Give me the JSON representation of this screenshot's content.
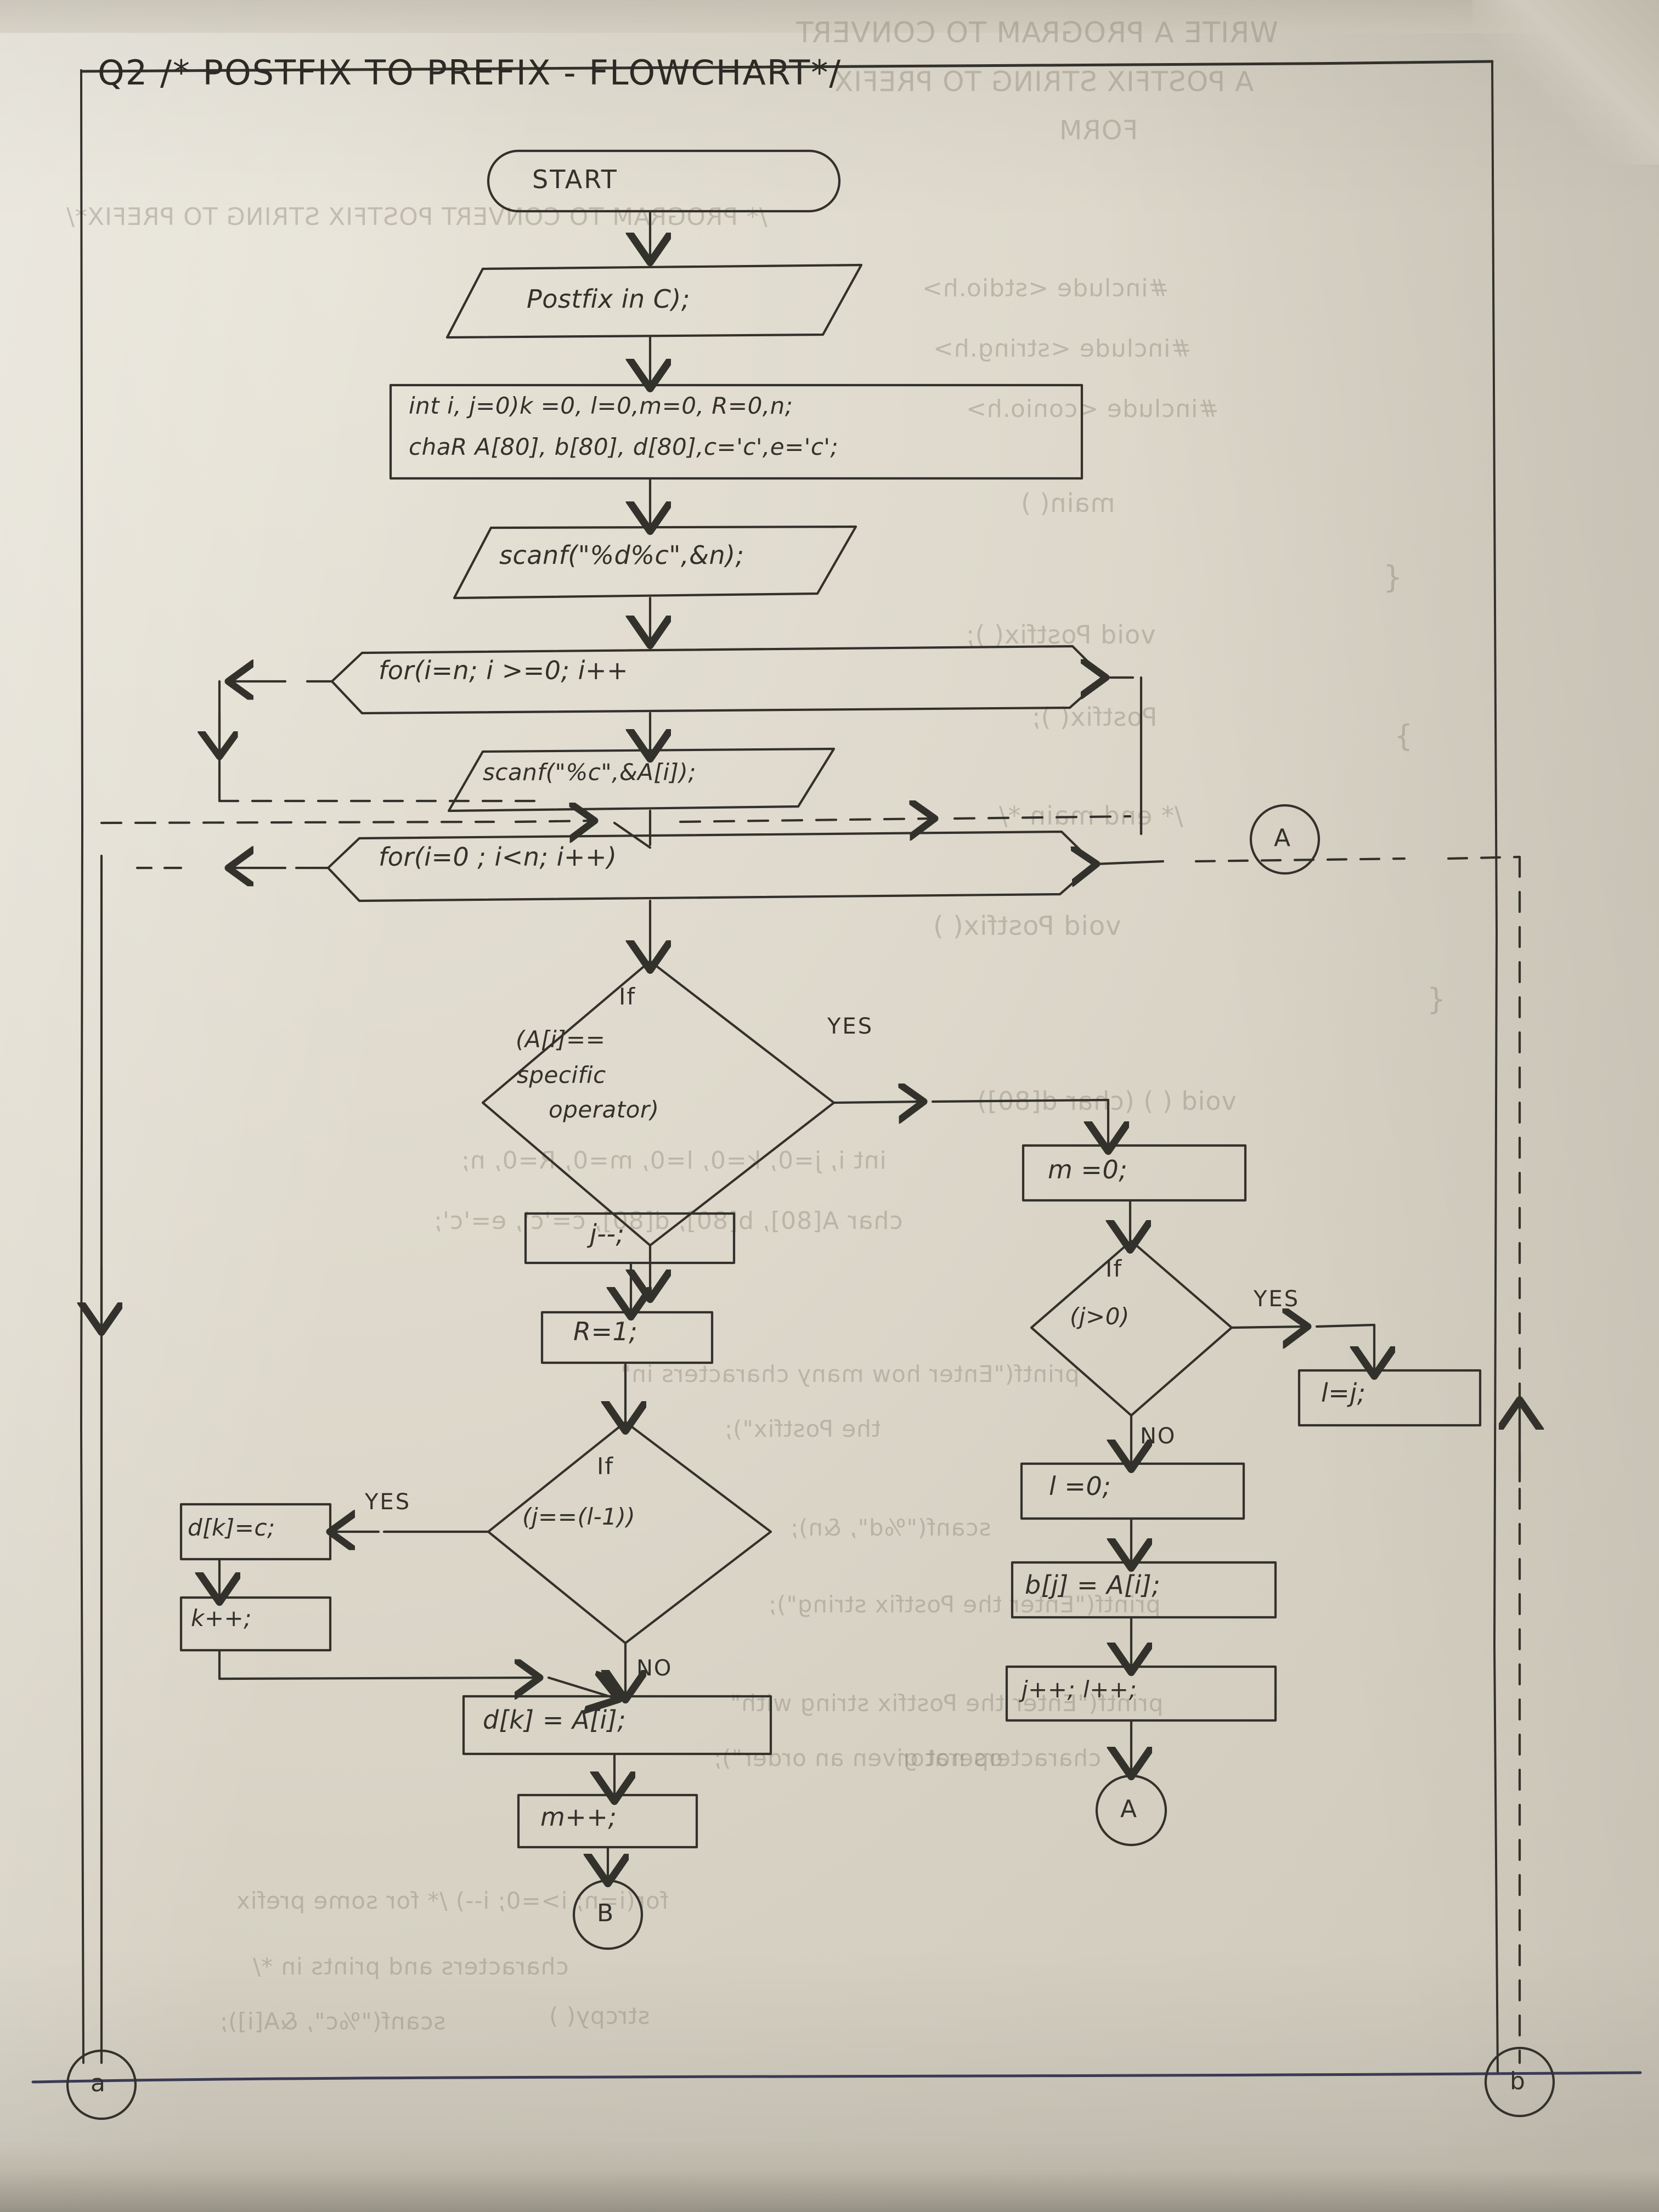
{
  "page": {
    "question_number": "Q2",
    "title": "/* POSTFIX TO PREFIX - FLOWCHART*/",
    "title_full": "Q2  /* POSTFIX TO PREFIX - FLOWCHART*/"
  },
  "flowchart": {
    "nodes": {
      "start": {
        "label": "START",
        "shape": "terminator"
      },
      "postfix_call": {
        "label": "Postfix in C);",
        "shape": "parallelogram"
      },
      "declarations": {
        "shape": "process",
        "line1": "int i, j=0)k =0, l=0,m=0, R=0,n;",
        "line2": "chaR A[80], b[80], d[80],c='c',e='c';"
      },
      "scanf_n": {
        "label": "scanf(\"%d%c\",&n);",
        "shape": "parallelogram"
      },
      "for_loop_1": {
        "label": "for(i=n; i >=0; i++",
        "shape": "hexagon"
      },
      "scanf_a": {
        "label": "scanf(\"%c\",&A[i]);",
        "shape": "parallelogram"
      },
      "for_loop_2": {
        "label": "for(i=0 ; i<n; i++)",
        "shape": "hexagon"
      },
      "if_operator": {
        "shape": "diamond",
        "line1": "If",
        "line2": "(A[i]==",
        "line3": "specific",
        "line4": "operator)"
      },
      "j_decrement": {
        "label": "j--;",
        "shape": "process"
      },
      "r_assign": {
        "label": "R=1;",
        "shape": "process"
      },
      "if_j_eq_l_minus_1": {
        "line1": "If",
        "line2": "(j==(l-1))",
        "shape": "diamond"
      },
      "d_k_eq_c": {
        "label": "d[k]=c;",
        "shape": "process"
      },
      "k_increment": {
        "label": "k++;",
        "shape": "process"
      },
      "d_k_eq_a_i": {
        "label": "d[k] = A[i];",
        "shape": "process"
      },
      "m_increment": {
        "label": "m++;",
        "shape": "process"
      },
      "connector_b": {
        "label": "B",
        "shape": "connector"
      },
      "m_assign_zero": {
        "label": "m =0;",
        "shape": "process"
      },
      "if_j_gt_0": {
        "line1": "If",
        "line2": "(j>0)",
        "shape": "diamond"
      },
      "l_eq_j": {
        "label": "l=j;",
        "shape": "process"
      },
      "l_eq_zero": {
        "label": "l =0;",
        "shape": "process"
      },
      "b_j_eq_a_i": {
        "label": "b[j] = A[i];",
        "shape": "process"
      },
      "j_l_increment": {
        "label": "j++;  l++;",
        "shape": "process"
      },
      "connector_a_bottom": {
        "label": "A",
        "shape": "connector"
      },
      "connector_a_right": {
        "label": "A",
        "shape": "connector"
      },
      "connector_a_lower_left": {
        "label": "a",
        "shape": "connector"
      },
      "connector_b_lower_right": {
        "label": "b",
        "shape": "connector"
      }
    },
    "edge_labels": {
      "yes_operator": "YES",
      "yes_j_eq_l": "YES",
      "no_j_eq_l": "NO",
      "yes_j_gt_0": "YES",
      "no_j_gt_0": "NO"
    }
  },
  "ghost_text": {
    "items": [
      "WRITE A PROGRAM TO CONVERT",
      "A POSTFIX STRING TO PREFIX",
      "FORM",
      "/* PROGRAM TO CONVERT POSTFIX STRING TO PREFIX*/",
      "#include <stdio.h>",
      "#include <string.h>",
      "#include <conio.h>",
      "main( )",
      "{",
      "void Postfix( );",
      "Postfix( );",
      "}",
      "/* end main */",
      "void Postfix( )",
      "{",
      "void ( ) (char d[80])",
      "int i, j=0, k=0, l=0, m=0, R=0, n;",
      "char A[80], b[80], d[80], c='c', e='c';",
      "printf(\"Enter how many characters in\"",
      "the Postfix\");",
      "scanf(\"%d\", &n);",
      "printf(\"Enter the Postfix string\");",
      "printf(\"Enter the Postfix string with\"",
      "characters not given an order\");",
      "for(i=n; i>=0; i--)  /* for some prefix",
      "characters and prints in */",
      "scanf(\"%c\", &A[i]);",
      "operator",
      "strcpy( )"
    ]
  },
  "colors": {
    "ink": "#33312b",
    "pencil": "#4a4740",
    "rule_line": "#3b3a55",
    "paper": "#ddd8ca"
  }
}
